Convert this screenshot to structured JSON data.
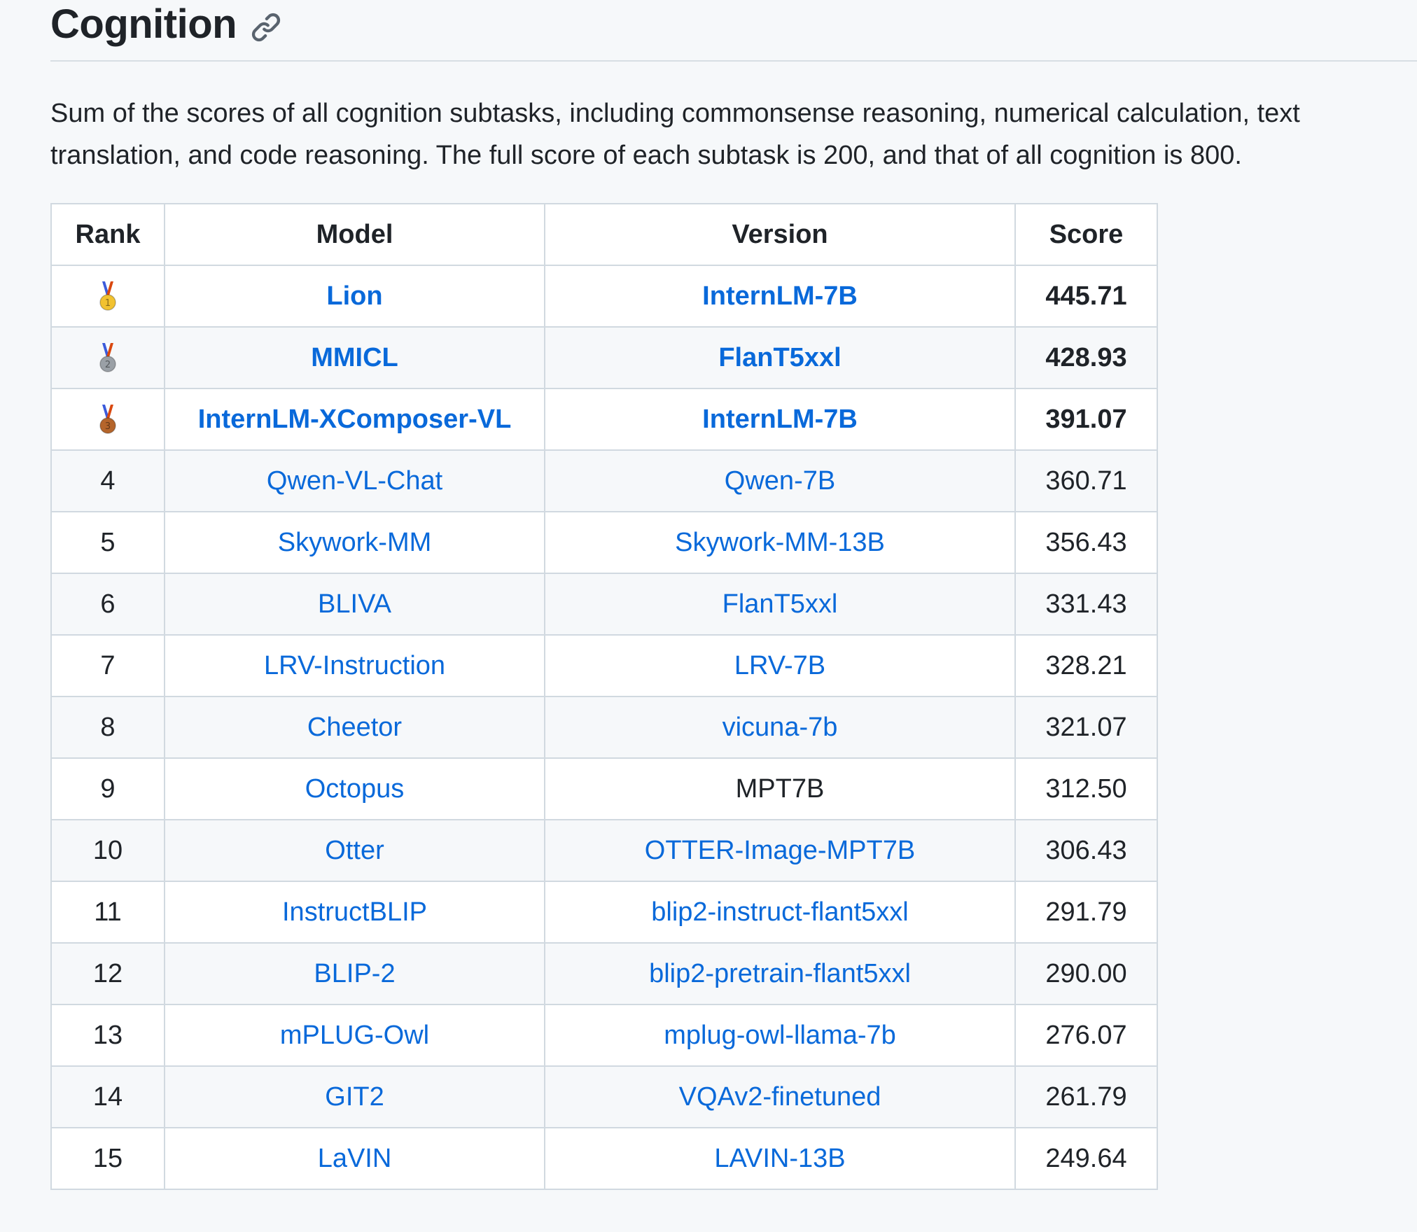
{
  "section": {
    "title": "Cognition",
    "description": "Sum of the scores of all cognition subtasks, including commonsense reasoning, numerical calculation, text translation, and code reasoning. The full score of each subtask is 200, and that of all cognition is 800."
  },
  "table": {
    "headers": {
      "rank": "Rank",
      "model": "Model",
      "version": "Version",
      "score": "Score"
    },
    "rows": [
      {
        "rank": "",
        "medal": "gold",
        "model": "Lion",
        "version": "InternLM-7B",
        "score": "445.71"
      },
      {
        "rank": "",
        "medal": "silver",
        "model": "MMICL",
        "version": "FlanT5xxl",
        "score": "428.93"
      },
      {
        "rank": "",
        "medal": "bronze",
        "model": "InternLM-XComposer-VL",
        "version": "InternLM-7B",
        "score": "391.07"
      },
      {
        "rank": "4",
        "model": "Qwen-VL-Chat",
        "version": "Qwen-7B",
        "score": "360.71"
      },
      {
        "rank": "5",
        "model": "Skywork-MM",
        "version": "Skywork-MM-13B",
        "score": "356.43"
      },
      {
        "rank": "6",
        "model": "BLIVA",
        "version": "FlanT5xxl",
        "score": "331.43"
      },
      {
        "rank": "7",
        "model": "LRV-Instruction",
        "version": "LRV-7B",
        "score": "328.21"
      },
      {
        "rank": "8",
        "model": "Cheetor",
        "version": "vicuna-7b",
        "score": "321.07"
      },
      {
        "rank": "9",
        "model": "Octopus",
        "version": "MPT7B",
        "score": "312.50"
      },
      {
        "rank": "10",
        "model": "Otter",
        "version": "OTTER-Image-MPT7B",
        "score": "306.43"
      },
      {
        "rank": "11",
        "model": "InstructBLIP",
        "version": "blip2-instruct-flant5xxl",
        "score": "291.79"
      },
      {
        "rank": "12",
        "model": "BLIP-2",
        "version": "blip2-pretrain-flant5xxl",
        "score": "290.00"
      },
      {
        "rank": "13",
        "model": "mPLUG-Owl",
        "version": "mplug-owl-llama-7b",
        "score": "276.07"
      },
      {
        "rank": "14",
        "model": "GIT2",
        "version": "VQAv2-finetuned",
        "score": "261.79"
      },
      {
        "rank": "15",
        "model": "LaVIN",
        "version": "LAVIN-13B",
        "score": "249.64"
      }
    ]
  },
  "colors": {
    "link": "#0969da",
    "text": "#1f2328",
    "border": "#d1d9e0",
    "row_alt": "#f6f8fa",
    "gold": "#f2c230",
    "silver": "#9aa0a6",
    "bronze": "#b5652b"
  }
}
